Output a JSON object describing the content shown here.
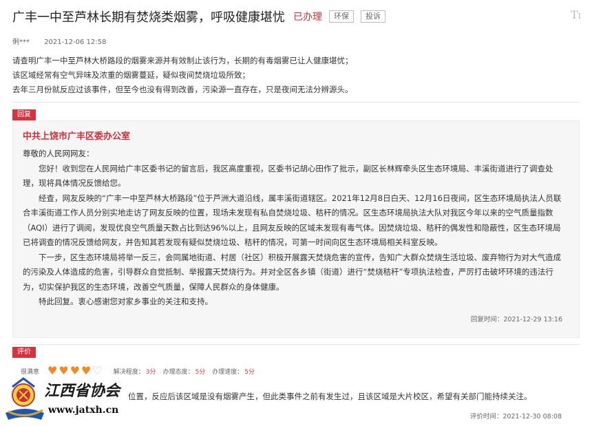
{
  "header": {
    "title": "广丰一中至芦林长期有焚烧类烟雾，呼吸健康堪忧",
    "status": "已办理",
    "tags": [
      "环保",
      "投诉"
    ],
    "font_toggle": "T"
  },
  "meta": {
    "author": "俐***",
    "date": "2021-12-06 12:58"
  },
  "question": {
    "lines": [
      "请查明广丰一中至芦林大桥路段的烟雾来源并有效制止该行为，长期的有毒烟雾已让人健康堪忧；",
      "该区域经常有空气异味及浓重的烟雾蔓延，疑似夜间焚烧垃圾所致；",
      "去年三月份就反应过该事件，但至今也没有得到改善，污染源一直存在，只是夜间无法分辨源头。"
    ]
  },
  "reply": {
    "badge": "回复",
    "org": "中共上饶市广丰区委办公室",
    "greeting": "尊敬的人民网网友：",
    "paragraphs": [
      "您好！收到您在人民网给广丰区委书记的留言后，我区高度重视，区委书记胡心田作了批示，副区长林辉牵头区生态环境局、丰溪街道进行了调查处理，现将具体情况反馈给您。",
      "经查，网友反映的“广丰一中至芦林大桥路段”位于芦洲大道沿线，属丰溪街道辖区。2021年12月8日白天、12月16日夜间，区生态环境局执法人员联合丰溪街道工作人员分别实地走访了网友反映的位置，现场未发现有私自焚烧垃圾、秸秆的情况。区生态环境局执法大队对我区今年以来的空气质量指数（AQI）进行了调阅，发现优良空气质量天数占比到达96%以上，且网友反映的区域未发现有毒气体。因焚烧垃圾、秸秆的偶发性和隐蔽性，区生态环境局已将调查的情况反馈给网友，并告知其若发现有疑似焚烧垃圾、秸秆的情况，可第一时间向区生态环境局相关科室反映。",
      "下一步，区生态环境局将举一反三，会同属地街道、村居（社区）积极开展露天焚烧危害的宣传，告知广大群众焚烧生活垃圾、废弃物行为对大气造成的污染及人体造成的危害，引导群众自觉抵制、举报露天焚烧行为。并对全区各乡镇（街道）进行“焚烧秸秆”专项执法检查，严厉打击破坏环境的违法行为，切实保护我区的生态环境，改善空气质量，保障人民群众的身体健康。",
      "特此回复。衷心感谢您对家乡事业的关注和支持。"
    ],
    "time_label": "回复时间：",
    "time": "2021-12-29 13:16"
  },
  "evaluation": {
    "badge": "评价",
    "rating_label": "很满意",
    "hearts": {
      "filled": 4,
      "total": 5
    },
    "scores": [
      {
        "label": "解决程度：",
        "value": "3分"
      },
      {
        "label": "办理态度：",
        "value": "5分"
      },
      {
        "label": "办理速度：",
        "value": "5分"
      }
    ],
    "text": "位置，反应后该区域是没有烟雾产生，但此类事件之前有发生过，且该区域是大片校区，希望有关部门能持续关注。",
    "time_label": "评价时间：",
    "time": "2021-12-30 08:08"
  },
  "watermark": {
    "text": "江西省协会",
    "url": "www.jatxh.cn"
  },
  "colors": {
    "accent": "#d8323e",
    "status": "#c8303a",
    "heart": "#f08a24"
  }
}
